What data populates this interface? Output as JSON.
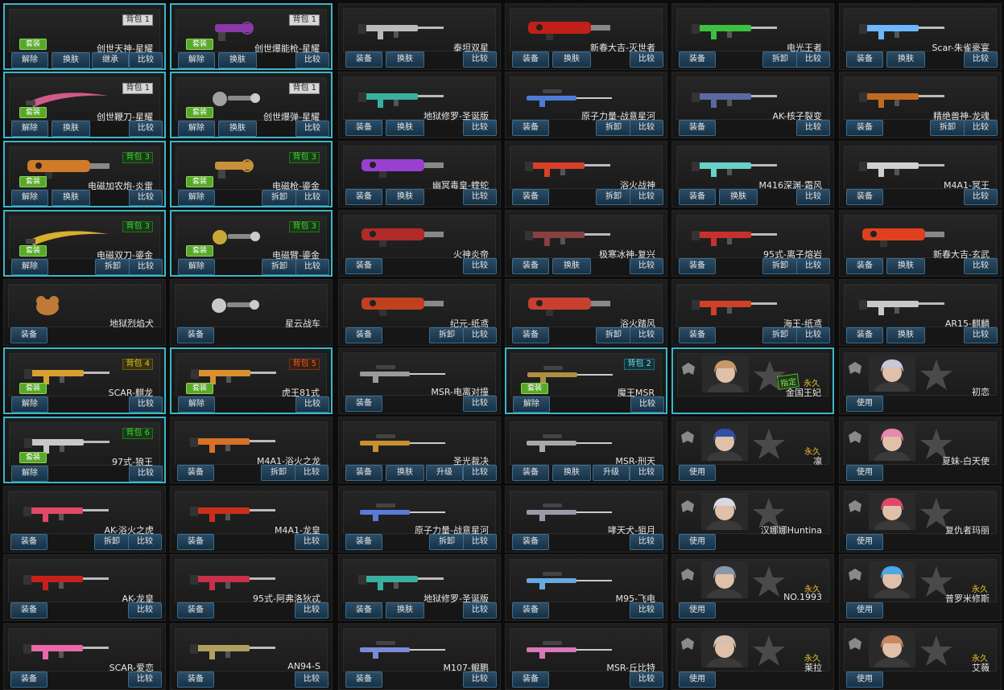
{
  "colors": {
    "selected_border": "#3cb6c8",
    "suit_badge": "#58a82a",
    "button": "#1f3f58",
    "permanent": "#e8c228"
  },
  "rows": [
    [
      {
        "sel": true,
        "bag": "背包 1",
        "bagc": "",
        "tz": "套装",
        "name": "创世天神-星耀",
        "img": "bow",
        "c": "#c03040",
        "btns": [
          {
            "t": "解除",
            "p": "b1"
          },
          {
            "t": "换肤",
            "p": "b2"
          },
          {
            "t": "继承",
            "p": "b3"
          },
          {
            "t": "比较",
            "p": "b4"
          }
        ]
      },
      {
        "sel": true,
        "bag": "背包 1",
        "bagc": "",
        "tz": "套装",
        "name": "创世爆能枪-星耀",
        "img": "pistol",
        "c": "#8a3aa8",
        "btns": [
          {
            "t": "解除",
            "p": "b1"
          },
          {
            "t": "换肤",
            "p": "b2"
          },
          {
            "t": "比较",
            "p": "b4"
          }
        ]
      },
      {
        "name": "泰坦双星",
        "img": "rifle",
        "c": "#bbbbbb",
        "btns": [
          {
            "t": "装备",
            "p": "b1"
          },
          {
            "t": "换肤",
            "p": "b2"
          },
          {
            "t": "比较",
            "p": "b4"
          }
        ]
      },
      {
        "name": "新春大吉-灭世者",
        "img": "heavy",
        "c": "#c02018",
        "btns": [
          {
            "t": "装备",
            "p": "b1"
          },
          {
            "t": "换肤",
            "p": "b2"
          },
          {
            "t": "比较",
            "p": "b4"
          }
        ]
      },
      {
        "name": "电光王者",
        "img": "rifle",
        "c": "#3cc040",
        "btns": [
          {
            "t": "装备",
            "p": "b1"
          },
          {
            "t": "拆卸",
            "p": "b2n"
          },
          {
            "t": "比较",
            "p": "b4"
          }
        ]
      },
      {
        "name": "Scar-朱雀豪宴",
        "img": "rifle",
        "c": "#6cb8ff",
        "btns": [
          {
            "t": "装备",
            "p": "b1"
          },
          {
            "t": "换肤",
            "p": "b2"
          },
          {
            "t": "比较",
            "p": "b4"
          }
        ]
      }
    ],
    [
      {
        "sel": true,
        "bag": "背包 1",
        "bagc": "",
        "tz": "套装",
        "name": "创世鞭刀-星耀",
        "img": "melee",
        "c": "#d05a8a",
        "btns": [
          {
            "t": "解除",
            "p": "b1"
          },
          {
            "t": "换肤",
            "p": "b2"
          },
          {
            "t": "比较",
            "p": "b4"
          }
        ]
      },
      {
        "sel": true,
        "bag": "背包 1",
        "bagc": "",
        "tz": "套装",
        "name": "创世爆弹-星耀",
        "img": "grenade",
        "c": "#a0a0a0",
        "btns": [
          {
            "t": "解除",
            "p": "b1"
          },
          {
            "t": "换肤",
            "p": "b2"
          },
          {
            "t": "比较",
            "p": "b4"
          }
        ]
      },
      {
        "name": "地狱修罗-圣诞版",
        "img": "rifle",
        "c": "#38b0a0",
        "btns": [
          {
            "t": "装备",
            "p": "b1"
          },
          {
            "t": "换肤",
            "p": "b2"
          },
          {
            "t": "比较",
            "p": "b4"
          }
        ]
      },
      {
        "name": "原子力量-战意星河",
        "img": "sniper",
        "c": "#4c7cd8",
        "btns": [
          {
            "t": "装备",
            "p": "b1"
          },
          {
            "t": "拆卸",
            "p": "b2n"
          },
          {
            "t": "比较",
            "p": "b4"
          }
        ]
      },
      {
        "name": "AK-核子裂变",
        "img": "rifle",
        "c": "#5a6aa0",
        "btns": [
          {
            "t": "装备",
            "p": "b1"
          },
          {
            "t": "比较",
            "p": "b4"
          }
        ]
      },
      {
        "name": "精绝兽神-龙魂",
        "img": "rifle",
        "c": "#c06a20",
        "btns": [
          {
            "t": "装备",
            "p": "b1"
          },
          {
            "t": "拆卸",
            "p": "b2n"
          },
          {
            "t": "比较",
            "p": "b4"
          }
        ]
      }
    ],
    [
      {
        "sel": true,
        "bag": "背包 3",
        "bagc": "green",
        "tz": "套装",
        "name": "电磁加农炮-炎雷",
        "img": "heavy",
        "c": "#d07a2a",
        "btns": [
          {
            "t": "解除",
            "p": "b1"
          },
          {
            "t": "换肤",
            "p": "b2"
          },
          {
            "t": "比较",
            "p": "b4"
          }
        ]
      },
      {
        "sel": true,
        "bag": "背包 3",
        "bagc": "green",
        "tz": "套装",
        "name": "电磁枪-鎏金",
        "img": "pistol",
        "c": "#c89038",
        "btns": [
          {
            "t": "解除",
            "p": "b1"
          },
          {
            "t": "拆卸",
            "p": "b2n"
          },
          {
            "t": "比较",
            "p": "b4"
          }
        ]
      },
      {
        "name": "幽冥毒皇-蝰蛇",
        "img": "heavy",
        "c": "#9a40d0",
        "btns": [
          {
            "t": "装备",
            "p": "b1"
          },
          {
            "t": "换肤",
            "p": "b2"
          },
          {
            "t": "比较",
            "p": "b4"
          }
        ]
      },
      {
        "name": "浴火战神",
        "img": "rifle",
        "c": "#d8402a",
        "btns": [
          {
            "t": "装备",
            "p": "b1"
          },
          {
            "t": "拆卸",
            "p": "b2n"
          },
          {
            "t": "比较",
            "p": "b4"
          }
        ]
      },
      {
        "name": "M416深渊-霜风",
        "img": "rifle",
        "c": "#68d0c8",
        "btns": [
          {
            "t": "装备",
            "p": "b1"
          },
          {
            "t": "换肤",
            "p": "b2"
          },
          {
            "t": "比较",
            "p": "b4"
          }
        ]
      },
      {
        "name": "M4A1-冥王",
        "img": "rifle",
        "c": "#d0d0d0",
        "btns": [
          {
            "t": "装备",
            "p": "b1"
          },
          {
            "t": "比较",
            "p": "b4"
          }
        ]
      }
    ],
    [
      {
        "sel": true,
        "bag": "背包 3",
        "bagc": "green",
        "tz": "套装",
        "name": "电磁双刀-鎏金",
        "img": "melee",
        "c": "#d8b030",
        "btns": [
          {
            "t": "解除",
            "p": "b1"
          },
          {
            "t": "拆卸",
            "p": "b2n"
          },
          {
            "t": "比较",
            "p": "b4"
          }
        ]
      },
      {
        "sel": true,
        "bag": "背包 3",
        "bagc": "green",
        "tz": "套装",
        "name": "电磁臂-鎏金",
        "img": "grenade",
        "c": "#c8a838",
        "btns": [
          {
            "t": "解除",
            "p": "b1"
          },
          {
            "t": "拆卸",
            "p": "b2n"
          },
          {
            "t": "比较",
            "p": "b4"
          }
        ]
      },
      {
        "name": "火神炎帝",
        "img": "heavy",
        "c": "#b02a2a",
        "btns": [
          {
            "t": "装备",
            "p": "b1"
          },
          {
            "t": "比较",
            "p": "b4"
          }
        ]
      },
      {
        "name": "极寒冰神-复兴",
        "img": "rifle",
        "c": "#884040",
        "btns": [
          {
            "t": "装备",
            "p": "b1"
          },
          {
            "t": "换肤",
            "p": "b2"
          },
          {
            "t": "比较",
            "p": "b4"
          }
        ]
      },
      {
        "name": "95式-离子熔岩",
        "img": "rifle",
        "c": "#c83030",
        "btns": [
          {
            "t": "装备",
            "p": "b1"
          },
          {
            "t": "拆卸",
            "p": "b2n"
          },
          {
            "t": "比较",
            "p": "b4"
          }
        ]
      },
      {
        "name": "新春大吉-玄武",
        "img": "heavy",
        "c": "#e04020",
        "btns": [
          {
            "t": "装备",
            "p": "b1"
          },
          {
            "t": "换肤",
            "p": "b2"
          },
          {
            "t": "比较",
            "p": "b4"
          }
        ]
      }
    ],
    [
      {
        "name": "地狱烈焰犬",
        "img": "pet",
        "c": "#c07a38",
        "btns": [
          {
            "t": "装备",
            "p": "b1"
          }
        ]
      },
      {
        "name": "星云战车",
        "img": "grenade",
        "c": "#c8c8c8",
        "btns": [
          {
            "t": "装备",
            "p": "b1"
          }
        ]
      },
      {
        "name": "纪元-纸鸢",
        "img": "heavy",
        "c": "#c04020",
        "btns": [
          {
            "t": "装备",
            "p": "b1"
          },
          {
            "t": "拆卸",
            "p": "b2n"
          },
          {
            "t": "比较",
            "p": "b4"
          }
        ]
      },
      {
        "name": "浴火踏风",
        "img": "heavy",
        "c": "#c84030",
        "btns": [
          {
            "t": "装备",
            "p": "b1"
          },
          {
            "t": "拆卸",
            "p": "b2n"
          },
          {
            "t": "比较",
            "p": "b4"
          }
        ]
      },
      {
        "name": "海王-纸鸢",
        "img": "rifle",
        "c": "#d04028",
        "btns": [
          {
            "t": "装备",
            "p": "b1"
          },
          {
            "t": "拆卸",
            "p": "b2n"
          },
          {
            "t": "比较",
            "p": "b4"
          }
        ]
      },
      {
        "name": "AR15-麒麟",
        "img": "rifle",
        "c": "#c8c8c8",
        "btns": [
          {
            "t": "装备",
            "p": "b1"
          },
          {
            "t": "换肤",
            "p": "b2"
          },
          {
            "t": "比较",
            "p": "b4"
          }
        ]
      }
    ],
    [
      {
        "sel": true,
        "bag": "背包 4",
        "bagc": "yellow",
        "tz": "套装",
        "name": "SCAR-麒龙",
        "img": "rifle",
        "c": "#d8a030",
        "btns": [
          {
            "t": "解除",
            "p": "b1"
          },
          {
            "t": "比较",
            "p": "b4"
          }
        ]
      },
      {
        "sel": true,
        "bag": "背包 5",
        "bagc": "orange",
        "tz": "套装",
        "name": "虎王81式",
        "img": "rifle",
        "c": "#d89030",
        "btns": [
          {
            "t": "解除",
            "p": "b1"
          },
          {
            "t": "比较",
            "p": "b4"
          }
        ]
      },
      {
        "name": "MSR-电离对撞",
        "img": "sniper",
        "c": "#9a9a9a",
        "btns": [
          {
            "t": "装备",
            "p": "b1"
          },
          {
            "t": "比较",
            "p": "b4"
          }
        ]
      },
      {
        "sel": true,
        "bag": "背包 2",
        "bagc": "cyan",
        "tz": "套装",
        "name": "魔王MSR",
        "img": "sniper",
        "c": "#b09040",
        "btns": [
          {
            "t": "解除",
            "p": "b1"
          },
          {
            "t": "比较",
            "p": "b4"
          }
        ]
      },
      {
        "sel": true,
        "role": true,
        "tag": "指定",
        "perm": "永久",
        "name": "金国王妃",
        "c": "#c89868",
        "btns": []
      },
      {
        "role": true,
        "name": "初恋",
        "c": "#c8c8d8",
        "btns": [
          {
            "t": "使用",
            "p": "b1"
          }
        ]
      }
    ],
    [
      {
        "sel": true,
        "bag": "背包 6",
        "bagc": "green",
        "tz": "套装",
        "name": "97式-狼王",
        "img": "rifle",
        "c": "#c8c8c8",
        "btns": [
          {
            "t": "解除",
            "p": "b1"
          },
          {
            "t": "比较",
            "p": "b4"
          }
        ]
      },
      {
        "name": "M4A1-浴火之龙",
        "img": "rifle",
        "c": "#d87028",
        "btns": [
          {
            "t": "装备",
            "p": "b1"
          },
          {
            "t": "拆卸",
            "p": "b2n"
          },
          {
            "t": "比较",
            "p": "b4"
          }
        ]
      },
      {
        "name": "圣光裁决",
        "img": "sniper",
        "c": "#c89030",
        "btns": [
          {
            "t": "装备",
            "p": "b1"
          },
          {
            "t": "换肤",
            "p": "b2"
          },
          {
            "t": "升级",
            "p": "b3"
          },
          {
            "t": "比较",
            "p": "b4"
          }
        ]
      },
      {
        "name": "MSR-刑天",
        "img": "sniper",
        "c": "#a8a8a8",
        "btns": [
          {
            "t": "装备",
            "p": "b1"
          },
          {
            "t": "换肤",
            "p": "b2"
          },
          {
            "t": "升级",
            "p": "b3"
          },
          {
            "t": "比较",
            "p": "b4"
          }
        ]
      },
      {
        "role": true,
        "perm": "永久",
        "name": "凛",
        "c": "#3050a8",
        "btns": [
          {
            "t": "使用",
            "p": "b1"
          }
        ]
      },
      {
        "role": true,
        "name": "夏妹-白天使",
        "c": "#e888b0",
        "btns": [
          {
            "t": "使用",
            "p": "b1"
          }
        ]
      }
    ],
    [
      {
        "name": "AK-浴火之虎",
        "img": "rifle",
        "c": "#e04868",
        "btns": [
          {
            "t": "装备",
            "p": "b1"
          },
          {
            "t": "拆卸",
            "p": "b2n"
          },
          {
            "t": "比较",
            "p": "b4"
          }
        ]
      },
      {
        "name": "M4A1-龙皇",
        "img": "rifle",
        "c": "#c83018",
        "btns": [
          {
            "t": "装备",
            "p": "b1"
          },
          {
            "t": "比较",
            "p": "b4"
          }
        ]
      },
      {
        "name": "原子力量-战意星河",
        "img": "sniper",
        "c": "#5a7ad8",
        "btns": [
          {
            "t": "装备",
            "p": "b1"
          },
          {
            "t": "拆卸",
            "p": "b2n"
          },
          {
            "t": "比较",
            "p": "b4"
          }
        ]
      },
      {
        "name": "哮天犬-狙月",
        "img": "sniper",
        "c": "#9a9aa8",
        "btns": [
          {
            "t": "装备",
            "p": "b1"
          },
          {
            "t": "比较",
            "p": "b4"
          }
        ]
      },
      {
        "role": true,
        "name": "汉娜娜Huntina",
        "c": "#d8d8e0",
        "btns": [
          {
            "t": "使用",
            "p": "b1"
          }
        ]
      },
      {
        "role": true,
        "name": "复仇者玛丽",
        "c": "#e04868",
        "btns": [
          {
            "t": "使用",
            "p": "b1"
          }
        ]
      }
    ],
    [
      {
        "name": "AK-龙皇",
        "img": "rifle",
        "c": "#c82018",
        "btns": [
          {
            "t": "装备",
            "p": "b1"
          },
          {
            "t": "比较",
            "p": "b4"
          }
        ]
      },
      {
        "name": "95式-阿弗洛狄忒",
        "img": "rifle",
        "c": "#c83048",
        "btns": [
          {
            "t": "装备",
            "p": "b1"
          },
          {
            "t": "比较",
            "p": "b4"
          }
        ]
      },
      {
        "name": "地狱修罗-圣诞版",
        "img": "rifle",
        "c": "#38b0a0",
        "btns": [
          {
            "t": "装备",
            "p": "b1"
          },
          {
            "t": "换肤",
            "p": "b2"
          },
          {
            "t": "比较",
            "p": "b4"
          }
        ]
      },
      {
        "name": "M95-飞电",
        "img": "sniper",
        "c": "#68a8e0",
        "btns": [
          {
            "t": "装备",
            "p": "b1"
          },
          {
            "t": "比较",
            "p": "b4"
          }
        ]
      },
      {
        "role": true,
        "perm": "永久",
        "name": "NO.1993",
        "c": "#8898a8",
        "btns": [
          {
            "t": "使用",
            "p": "b1"
          }
        ]
      },
      {
        "role": true,
        "perm": "永久",
        "name": "普罗米修斯",
        "c": "#48a8e8",
        "btns": [
          {
            "t": "使用",
            "p": "b1"
          }
        ]
      }
    ],
    [
      {
        "name": "SCAR-爱恋",
        "img": "rifle",
        "c": "#e868a8",
        "btns": [
          {
            "t": "装备",
            "p": "b1"
          },
          {
            "t": "比较",
            "p": "b4"
          }
        ]
      },
      {
        "name": "AN94-S",
        "img": "rifle",
        "c": "#b0a060",
        "btns": [
          {
            "t": "装备",
            "p": "b1"
          },
          {
            "t": "比较",
            "p": "b4"
          }
        ]
      },
      {
        "name": "M107-鲲鹏",
        "img": "sniper",
        "c": "#7a8ad8",
        "btns": [
          {
            "t": "装备",
            "p": "b1"
          },
          {
            "t": "比较",
            "p": "b4"
          }
        ]
      },
      {
        "name": "MSR-丘比特",
        "img": "sniper",
        "c": "#d878b8",
        "btns": [
          {
            "t": "装备",
            "p": "b1"
          },
          {
            "t": "比较",
            "p": "b4"
          }
        ]
      },
      {
        "role": true,
        "perm": "永久",
        "name": "莱拉",
        "c": "#d8c0b0",
        "btns": [
          {
            "t": "使用",
            "p": "b1"
          }
        ]
      },
      {
        "role": true,
        "perm": "永久",
        "name": "艾薇",
        "c": "#c88860",
        "btns": [
          {
            "t": "使用",
            "p": "b1"
          }
        ]
      }
    ]
  ]
}
